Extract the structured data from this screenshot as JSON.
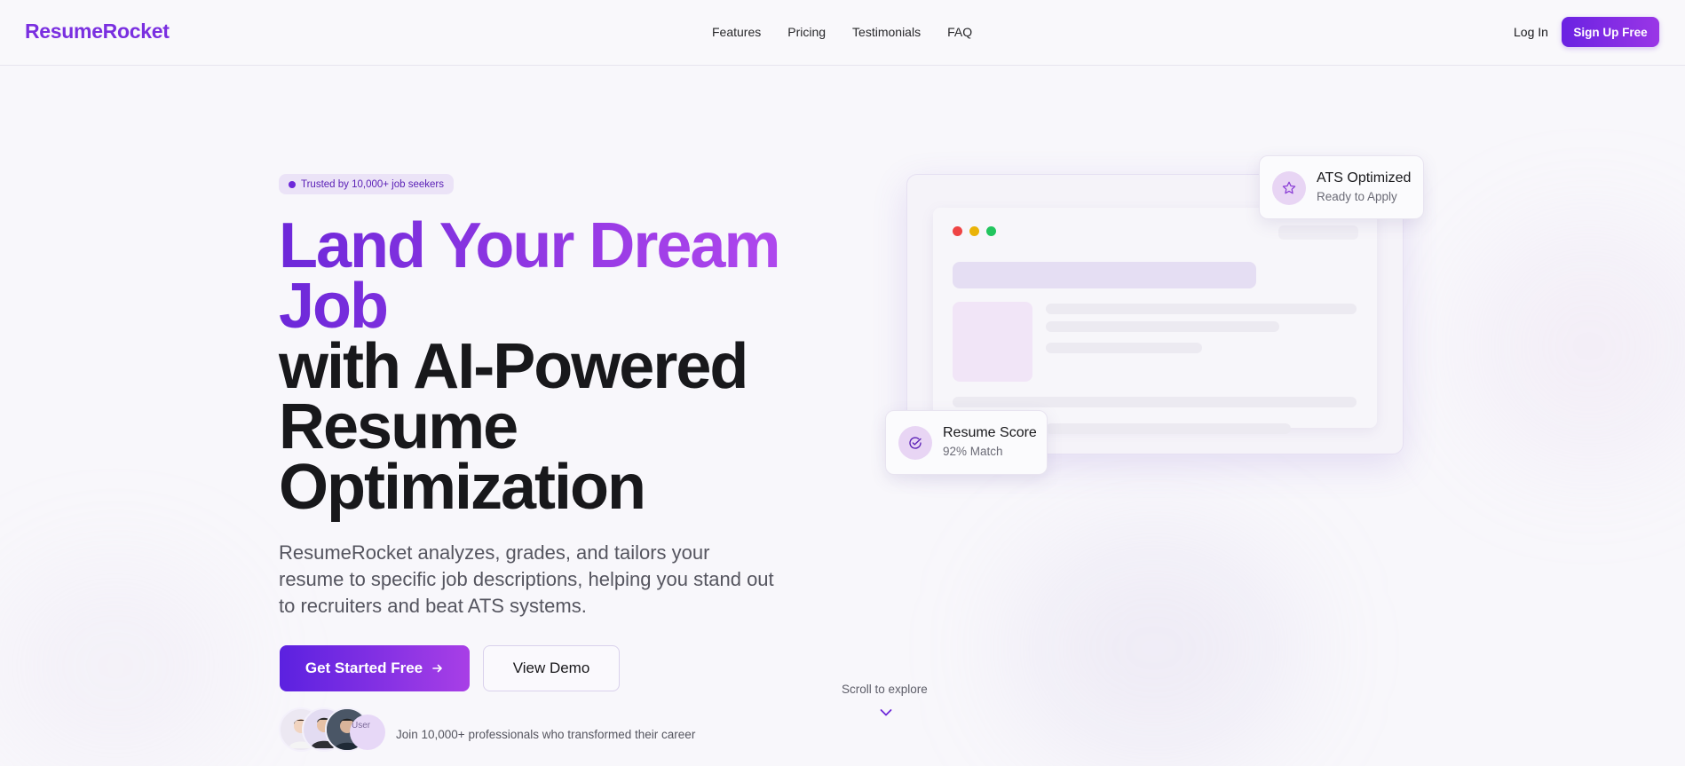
{
  "brand": {
    "name": "ResumeRocket",
    "accent": "#7a2fe0",
    "accent_end": "#a83fe6"
  },
  "nav": {
    "items": [
      "Features",
      "Pricing",
      "Testimonials",
      "FAQ"
    ]
  },
  "auth": {
    "login_label": "Log In",
    "signup_label": "Sign Up Free"
  },
  "hero": {
    "badge": "Trusted by 10,000+ job seekers",
    "headline_gradient_1": "Land Your Dream",
    "headline_gradient_2": "Job",
    "headline_dark_1": "with AI-Powered",
    "headline_dark_2": "Resume",
    "headline_dark_3": "Optimization",
    "subtext": "ResumeRocket analyzes, grades, and tailors your resume to specific job descriptions, helping you stand out to recruiters and beat ATS systems.",
    "cta_primary": "Get Started Free",
    "cta_secondary": "View Demo",
    "avatar_alt": "User",
    "social_proof": "Join 10,000+ professionals who transformed their career"
  },
  "scroll": {
    "label": "Scroll to explore"
  },
  "cards": {
    "ats": {
      "title": "ATS Optimized",
      "subtitle": "Ready to Apply",
      "icon": "star-icon"
    },
    "score": {
      "title": "Resume Score",
      "subtitle": "92% Match",
      "icon": "check-circle-icon"
    }
  }
}
